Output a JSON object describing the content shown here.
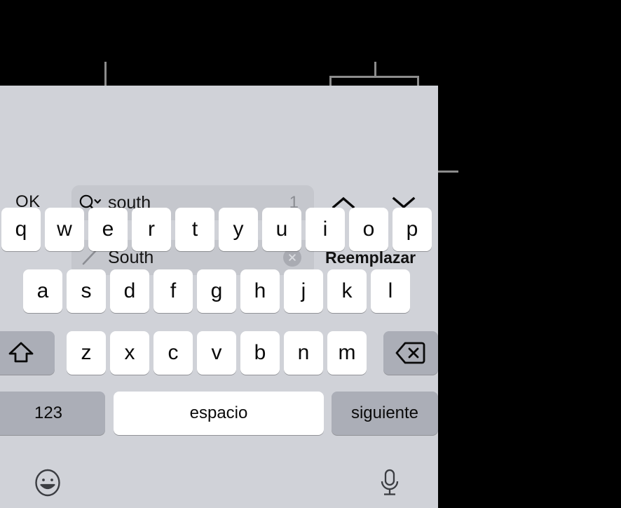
{
  "toolbar": {
    "ok_label": "OK",
    "find": {
      "icon": "search-icon",
      "value": "south",
      "match_count": "1"
    },
    "replace": {
      "icon": "pencil-icon",
      "value": "South",
      "clear_icon": "close-circle-icon"
    },
    "nav_prev_icon": "chevron-up-icon",
    "nav_next_icon": "chevron-down-icon",
    "replace_button_label": "Reemplazar"
  },
  "keyboard": {
    "row1": [
      "q",
      "w",
      "e",
      "r",
      "t",
      "y",
      "u",
      "i",
      "o",
      "p"
    ],
    "row2": [
      "a",
      "s",
      "d",
      "f",
      "g",
      "h",
      "j",
      "k",
      "l"
    ],
    "row3": [
      "z",
      "x",
      "c",
      "v",
      "b",
      "n",
      "m"
    ],
    "shift_icon": "shift-arrow-icon",
    "backspace_icon": "backspace-icon",
    "numbers_label": "123",
    "space_label": "espacio",
    "next_label": "siguiente",
    "emoji_icon": "emoji-smiley-icon",
    "mic_icon": "microphone-icon"
  },
  "colors": {
    "backdrop": "#000000",
    "panel": "#d0d2d8",
    "field": "#c5c7cd",
    "key": "#ffffff",
    "key_special": "#abaeb7",
    "text": "#0a0a0a",
    "muted": "#8b8d93",
    "callout": "#8c8c8c"
  },
  "callouts": {
    "search_pointer": "leader-line-to-search-icon",
    "arrows_bracket": "bracket-over-navigation-arrows",
    "replace_pointer": "leader-line-to-replace-button"
  }
}
